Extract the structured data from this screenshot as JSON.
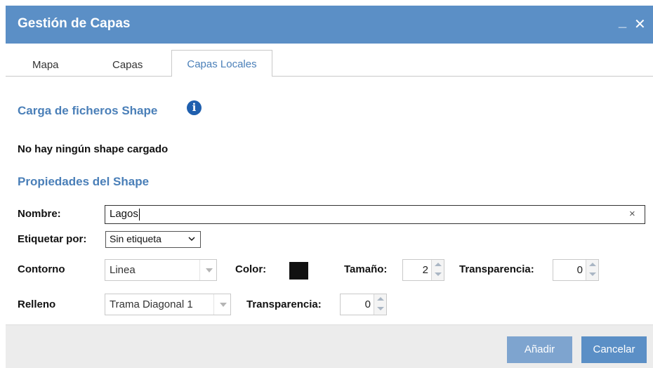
{
  "window": {
    "title": "Gestión de Capas",
    "minimize_glyph": "_",
    "close_glyph": "✕"
  },
  "tabs": [
    {
      "label": "Mapa"
    },
    {
      "label": "Capas"
    },
    {
      "label": "Capas Locales",
      "active": true
    }
  ],
  "carga": {
    "heading": "Carga de ficheros Shape",
    "info_icon": "info-icon",
    "status": "No hay ningún shape cargado"
  },
  "props": {
    "heading": "Propiedades del Shape",
    "nombre_label": "Nombre:",
    "nombre_value": "Lagos",
    "clear_glyph": "×",
    "etiquetar_label": "Etiquetar por:",
    "etiquetar_value": "Sin etiqueta",
    "contorno_label": "Contorno",
    "contorno_value": "Linea",
    "color_label": "Color:",
    "color_value": "#111111",
    "tamano_label": "Tamaño:",
    "tamano_value": "2",
    "transp1_label": "Transparencia:",
    "transp1_value": "0",
    "relleno_label": "Relleno",
    "relleno_value": "Trama Diagonal 1",
    "transp2_label": "Transparencia:",
    "transp2_value": "0"
  },
  "footer": {
    "add_label": "Añadir",
    "cancel_label": "Cancelar"
  },
  "colors": {
    "accent": "#5b8fc6",
    "heading": "#4a7fb8",
    "button_disabled": "#7ea4cf"
  }
}
